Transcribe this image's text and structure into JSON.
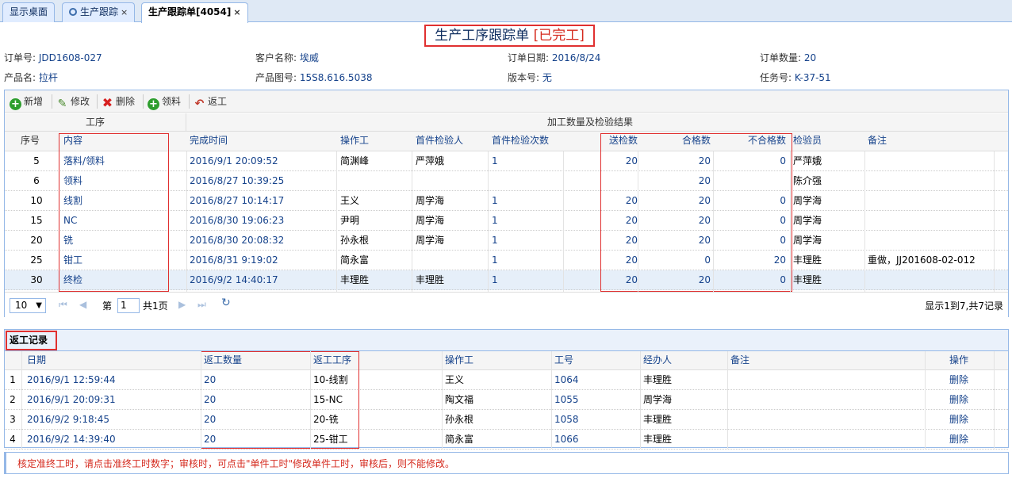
{
  "tabs": [
    {
      "label": "显示桌面",
      "closable": false,
      "icon": null
    },
    {
      "label": "生产跟踪",
      "closable": true,
      "icon": "search-icon"
    },
    {
      "label": "生产跟踪单[4054]",
      "closable": true,
      "icon": null,
      "active": true
    }
  ],
  "close_glyph": "×",
  "header": {
    "title": "生产工序跟踪单",
    "status": "[已完工]"
  },
  "order_info": {
    "order_no_label": "订单号:",
    "order_no": "JDD1608-027",
    "customer_label": "客户名称:",
    "customer": "埃威",
    "order_date_label": "订单日期:",
    "order_date": "2016/8/24",
    "quantity_label": "订单数量:",
    "quantity": "20",
    "product_label": "产品名:",
    "product": "拉杆",
    "drawing_label": "产品图号:",
    "drawing": "15S8.616.5038",
    "version_label": "版本号:",
    "version": "无",
    "task_label": "任务号:",
    "task": "K-37-51"
  },
  "toolbar": {
    "add": "新增",
    "edit": "修改",
    "delete": "删除",
    "pick": "领料",
    "rework": "返工"
  },
  "process_grid": {
    "group_headers": {
      "process": "工序",
      "result": "加工数量及检验结果"
    },
    "columns": {
      "seq": "序号",
      "content": "内容",
      "finish_time": "完成时间",
      "operator": "操作工",
      "first_inspector": "首件检验人",
      "first_count": "首件检验次数",
      "sent": "送检数",
      "qualified": "合格数",
      "unqualified": "不合格数",
      "inspector": "检验员",
      "remark": "备注"
    },
    "rows": [
      {
        "seq": "5",
        "content": "落料/领料",
        "finish_time": "2016/9/1 20:09:52",
        "operator": "简渊峰",
        "first_inspector": "严萍娥",
        "first_count": "1",
        "sent": "20",
        "qualified": "20",
        "unqualified": "0",
        "inspector": "严萍娥",
        "remark": ""
      },
      {
        "seq": "6",
        "content": "领料",
        "finish_time": "2016/8/27 10:39:25",
        "operator": "",
        "first_inspector": "",
        "first_count": "",
        "sent": "",
        "qualified": "20",
        "unqualified": "",
        "inspector": "陈介强",
        "remark": ""
      },
      {
        "seq": "10",
        "content": "线割",
        "finish_time": "2016/8/27 10:14:17",
        "operator": "王义",
        "first_inspector": "周学海",
        "first_count": "1",
        "sent": "20",
        "qualified": "20",
        "unqualified": "0",
        "inspector": "周学海",
        "remark": ""
      },
      {
        "seq": "15",
        "content": "NC",
        "finish_time": "2016/8/30 19:06:23",
        "operator": "尹明",
        "first_inspector": "周学海",
        "first_count": "1",
        "sent": "20",
        "qualified": "20",
        "unqualified": "0",
        "inspector": "周学海",
        "remark": ""
      },
      {
        "seq": "20",
        "content": "铣",
        "finish_time": "2016/8/30 20:08:32",
        "operator": "孙永根",
        "first_inspector": "周学海",
        "first_count": "1",
        "sent": "20",
        "qualified": "20",
        "unqualified": "0",
        "inspector": "周学海",
        "remark": ""
      },
      {
        "seq": "25",
        "content": "钳工",
        "finish_time": "2016/8/31 9:19:02",
        "operator": "简永富",
        "first_inspector": "",
        "first_count": "1",
        "sent": "20",
        "qualified": "0",
        "unqualified": "20",
        "inspector": "丰理胜",
        "remark": "重做，JJ201608-02-012"
      },
      {
        "seq": "30",
        "content": "终检",
        "finish_time": "2016/9/2 14:40:17",
        "operator": "丰理胜",
        "first_inspector": "丰理胜",
        "first_count": "1",
        "sent": "20",
        "qualified": "20",
        "unqualified": "0",
        "inspector": "丰理胜",
        "remark": ""
      }
    ],
    "pager": {
      "page_size": "10",
      "dropdown": "▼",
      "page_prefix": "第",
      "page": "1",
      "page_suffix": "共1页",
      "summary": "显示1到7,共7记录",
      "first_glyph": "⏮",
      "prev_glyph": "◀",
      "next_glyph": "▶",
      "last_glyph": "⏭",
      "refresh_glyph": "↻"
    }
  },
  "rework": {
    "title": "返工记录",
    "columns": {
      "date": "日期",
      "qty": "返工数量",
      "process": "返工工序",
      "operator": "操作工",
      "worker_no": "工号",
      "handler": "经办人",
      "remark": "备注",
      "action": "操作"
    },
    "rows": [
      {
        "idx": "1",
        "date": "2016/9/1 12:59:44",
        "qty": "20",
        "process": "10-线割",
        "operator": "王义",
        "worker_no": "1064",
        "handler": "丰理胜",
        "remark": "",
        "action": "删除"
      },
      {
        "idx": "2",
        "date": "2016/9/1 20:09:31",
        "qty": "20",
        "process": "15-NC",
        "operator": "陶文福",
        "worker_no": "1055",
        "handler": "周学海",
        "remark": "",
        "action": "删除"
      },
      {
        "idx": "3",
        "date": "2016/9/2 9:18:45",
        "qty": "20",
        "process": "20-铣",
        "operator": "孙永根",
        "worker_no": "1058",
        "handler": "丰理胜",
        "remark": "",
        "action": "删除"
      },
      {
        "idx": "4",
        "date": "2016/9/2 14:39:40",
        "qty": "20",
        "process": "25-钳工",
        "operator": "简永富",
        "worker_no": "1066",
        "handler": "丰理胜",
        "remark": "",
        "action": "删除"
      }
    ]
  },
  "note": "核定准终工时，请点击准终工时数字；审核时，可点击\"单件工时\"修改单件工时，审核后，则不能修改。",
  "colors": {
    "accent": "#15428b",
    "highlight_border": "#e03030",
    "status_red": "#d52a1e",
    "border": "#95b8e7"
  }
}
